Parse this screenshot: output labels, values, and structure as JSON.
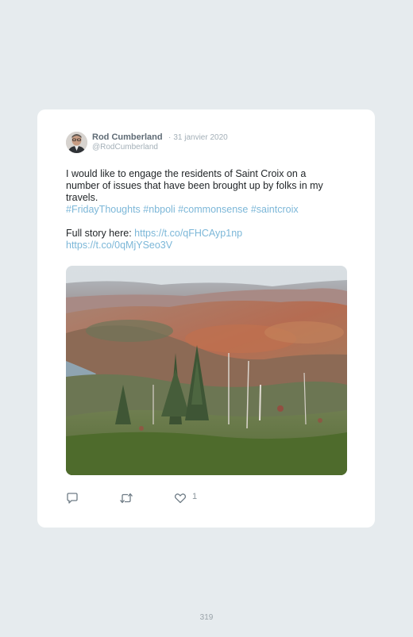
{
  "tweet": {
    "author": {
      "name": "Rod Cumberland",
      "handle": "@RodCumberland",
      "date": "31 janvier 2020",
      "separator": "·"
    },
    "text_lines": [
      "I would like to engage the residents of Saint Croix on a",
      "number of issues that have been brought up by folks in my",
      "travels."
    ],
    "hashtags": [
      "#FridayThoughts",
      "#nbpoli",
      "#commonsense",
      "#saintcroix"
    ],
    "story_prefix": "Full story here:",
    "links": [
      "https://t.co/qFHCAyp1np",
      "https://t.co/0qMjYSeo3V"
    ],
    "actions": {
      "reply_icon": "reply-icon",
      "retweet_icon": "retweet-icon",
      "like_icon": "heart-icon",
      "like_count": "1"
    }
  },
  "page": {
    "number": "319"
  }
}
